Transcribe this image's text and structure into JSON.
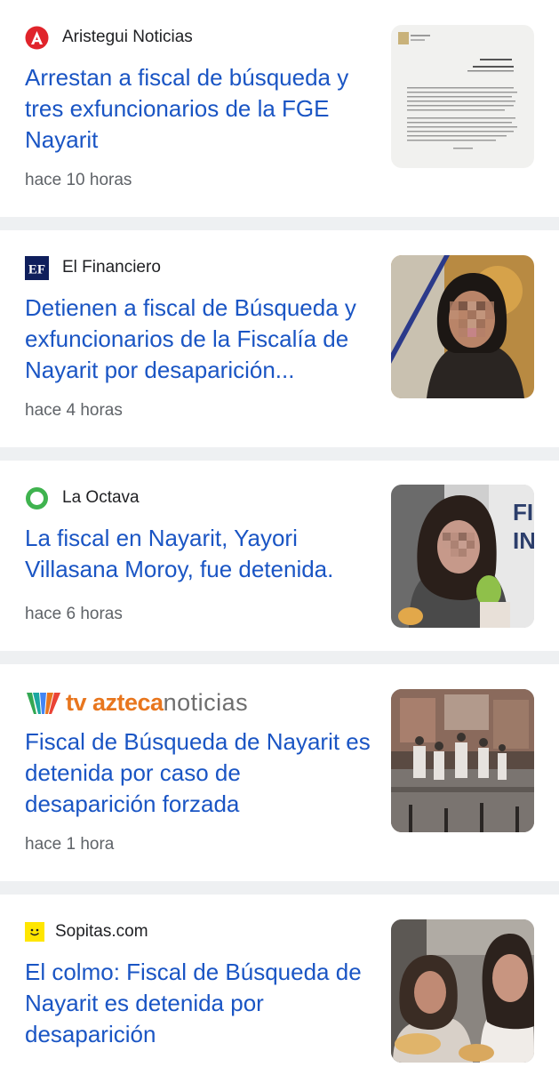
{
  "articles": [
    {
      "source": "Aristegui Noticias",
      "logo_icon": "aristegui-logo-icon",
      "headline": "Arrestan a fiscal de búsqueda y tres exfuncionarios de la FGE Nayarit",
      "time": "hace 10 horas",
      "thumb_icon": "document-thumbnail"
    },
    {
      "source": "El Financiero",
      "logo_icon": "el-financiero-logo-icon",
      "headline": "Detienen a fiscal de Búsqueda y exfuncionarios de la Fiscalía de Nayarit por desaparición...",
      "time": "hace 4 horas",
      "thumb_icon": "portrait-thumbnail"
    },
    {
      "source": "La Octava",
      "logo_icon": "la-octava-logo-icon",
      "headline": "La fiscal en Nayarit, Yayori Villasana Moroy, fue detenida.",
      "time": "hace 6 horas",
      "thumb_icon": "press-photo-thumbnail"
    },
    {
      "source_logo_text_1": "tv azteca",
      "source_logo_text_2": "noticias",
      "logo_icon": "tv-azteca-logo-icon",
      "headline": "Fiscal de Búsqueda de Nayarit es detenida por caso de desaparición forzada",
      "time": "hace 1 hora",
      "thumb_icon": "protest-photo-thumbnail"
    },
    {
      "source": "Sopitas.com",
      "logo_icon": "sopitas-logo-icon",
      "headline": "El colmo: Fiscal de Búsqueda de Nayarit es detenida por desaparición",
      "thumb_icon": "women-photo-thumbnail"
    }
  ],
  "colors": {
    "headline": "#1a55c4",
    "source": "#202124",
    "timestamp": "#5f6368",
    "divider": "#eef0f2",
    "aristegui_red": "#e0242b",
    "octava_green": "#3fb34f",
    "azteca_orange": "#e8761e",
    "sopitas_yellow": "#ffe600"
  }
}
